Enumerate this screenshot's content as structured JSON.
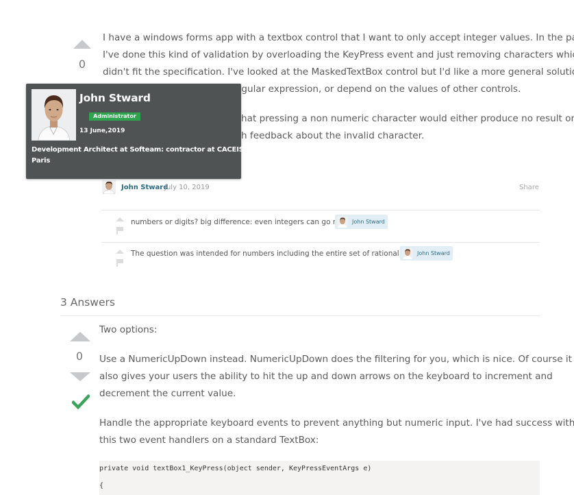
{
  "question": {
    "vote_count": "0",
    "paragraphs": [
      "I have a windows forms app with a textbox control that I want to only accept integer values. In the past",
      "I've done this kind of validation by overloading the KeyPress event and just removing characters which",
      "didn't fit the specification. I've looked at the MaskedTextBox control but I'd like a more general solution",
      "egular expression, or depend on the values of other controls.",
      "hat pressing a non numeric character would either produce no result or",
      "h feedback about the invalid character."
    ],
    "author": "John Stward",
    "date": "July 10, 2019",
    "share_label": "Share"
  },
  "comments": [
    {
      "text": "numbers or digits? big difference: even integers can go negative",
      "user": "John Stward"
    },
    {
      "text": "The question was intended for numbers including the entire set of rational numbers.",
      "user": "John Stward"
    }
  ],
  "profile_popup": {
    "name": "John Stward",
    "role": "Administrator",
    "joined": "13 June,2019",
    "bio_line1": "Development Architect at Softeam: contractor at CACEIS",
    "bio_line2": "Paris"
  },
  "answers": {
    "title": "3 Answers",
    "first": {
      "vote_count": "0",
      "intro": "Two options:",
      "p1_line1": "Use a NumericUpDown instead. NumericUpDown does the filtering for you, which is nice. Of course it",
      "p1_line2": "also gives your users the ability to hit the up and down arrows on the keyboard to increment and",
      "p1_line3": "decrement the current value.",
      "p2_line1": "Handle the appropriate keyboard events to prevent anything but numeric input. I've had success with",
      "p2_line2": "this two event handlers on a standard TextBox:",
      "code_line1": "private void textBox1_KeyPress(object sender, KeyPressEventArgs e)",
      "code_line2": "{"
    }
  }
}
